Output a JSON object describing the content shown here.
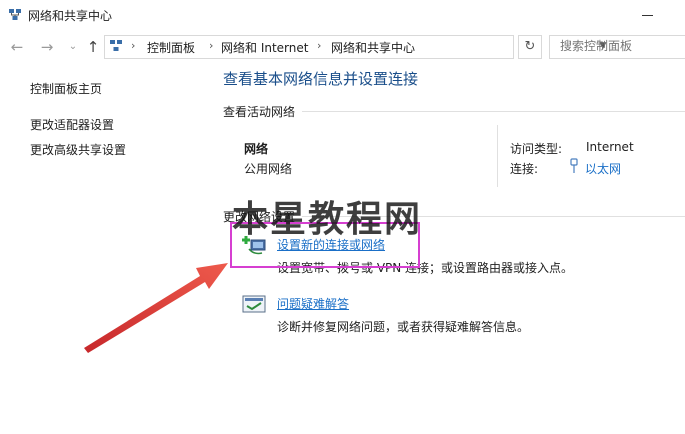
{
  "window": {
    "title": "网络和共享中心"
  },
  "address_bar": {
    "crumbs": [
      "控制面板",
      "网络和 Internet",
      "网络和共享中心"
    ],
    "separator": "›"
  },
  "search": {
    "placeholder": "搜索控制面板"
  },
  "sidebar": {
    "items": [
      {
        "label": "控制面板主页"
      },
      {
        "label": "更改适配器设置"
      },
      {
        "label": "更改高级共享设置"
      }
    ]
  },
  "main": {
    "heading": "查看基本网络信息并设置连接",
    "active_networks_title": "查看活动网络",
    "network": {
      "name": "网络",
      "type": "公用网络",
      "access_type_label": "访问类型:",
      "access_type_value": "Internet",
      "connections_label": "连接:",
      "connections_value": "以太网"
    },
    "change_settings_title": "更改网络设置",
    "tasks": [
      {
        "link": "设置新的连接或网络",
        "desc": "设置宽带、拨号或 VPN 连接；或设置路由器或接入点。",
        "icon": "new-connection-icon"
      },
      {
        "link": "问题疑难解答",
        "desc": "诊断并修复网络问题，或者获得疑难解答信息。",
        "icon": "troubleshoot-icon"
      }
    ]
  },
  "annotations": {
    "watermark": "本星教程网",
    "highlight_color": "#d63fd1",
    "arrow_color": "#e8463a"
  }
}
